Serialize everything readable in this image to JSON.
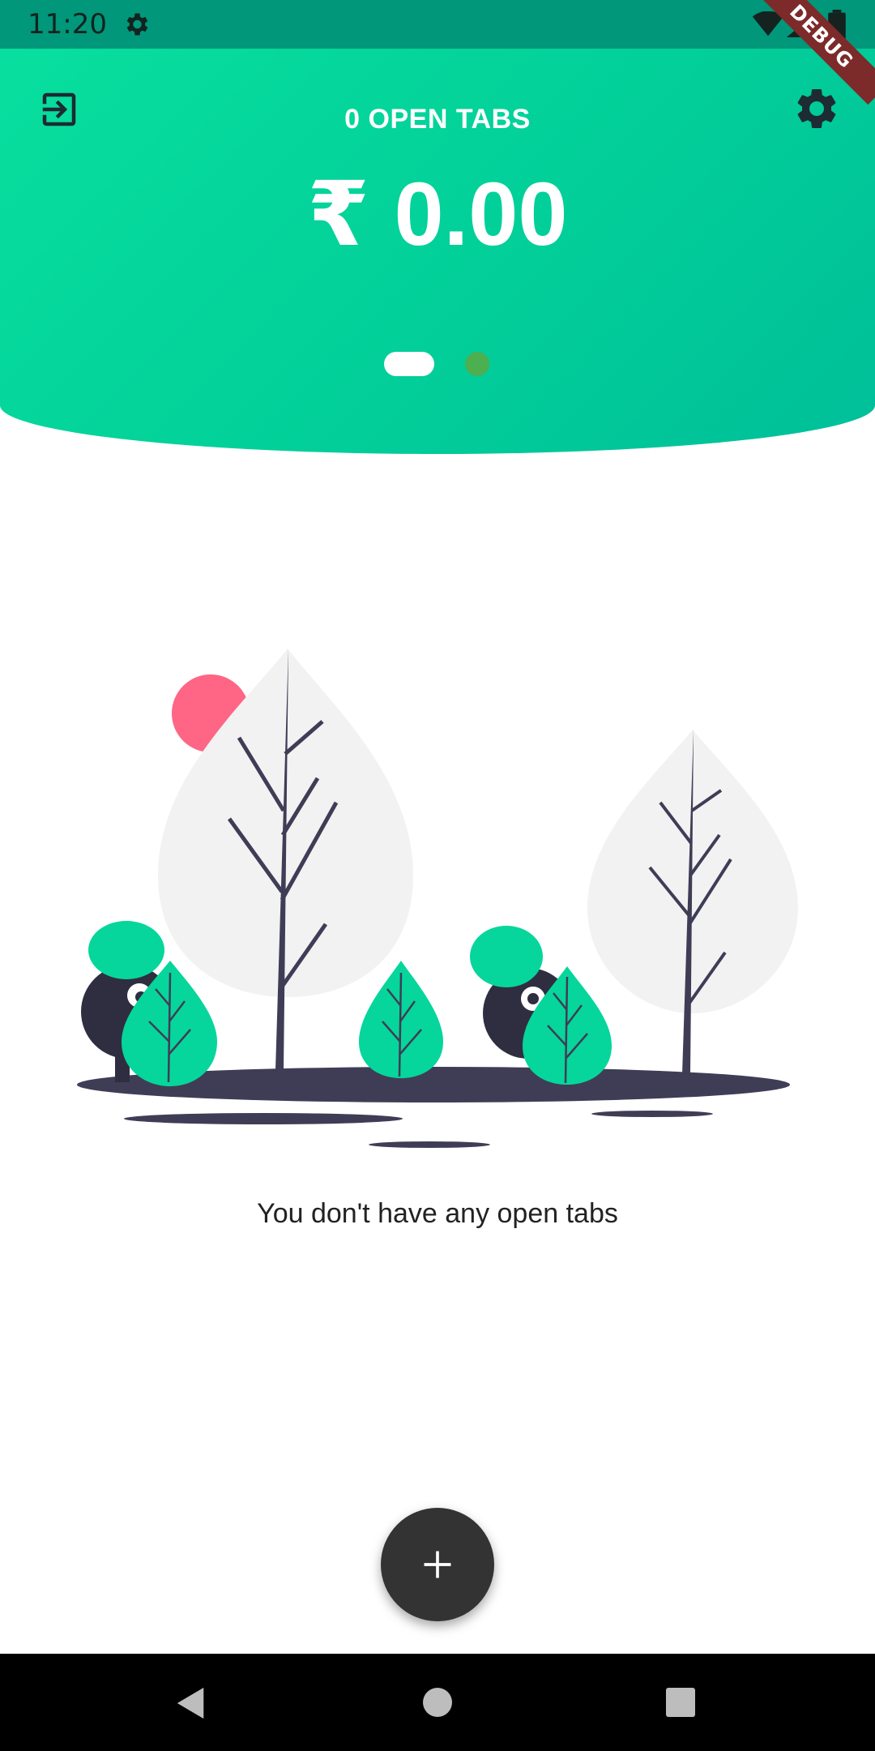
{
  "status_bar": {
    "time": "11:20"
  },
  "debug_banner": "DEBUG",
  "header": {
    "open_tabs_label": "0 OPEN TABS",
    "total_amount": "₹ 0.00",
    "page_indicator": {
      "pages": 2,
      "active": 1
    }
  },
  "empty_state": {
    "message": "You don't have any open tabs"
  },
  "colors": {
    "header_gradient_start": "#08df9e",
    "header_gradient_end": "#00bf99",
    "status_bar": "#00977a",
    "fab": "#333333",
    "accent_leaf": "#06d69b",
    "sun": "#ff6584",
    "dot_inactive": "#4caf50"
  },
  "icons": {
    "exit": "exit-to-app-icon",
    "settings": "gear-icon",
    "fab": "plus-icon"
  }
}
